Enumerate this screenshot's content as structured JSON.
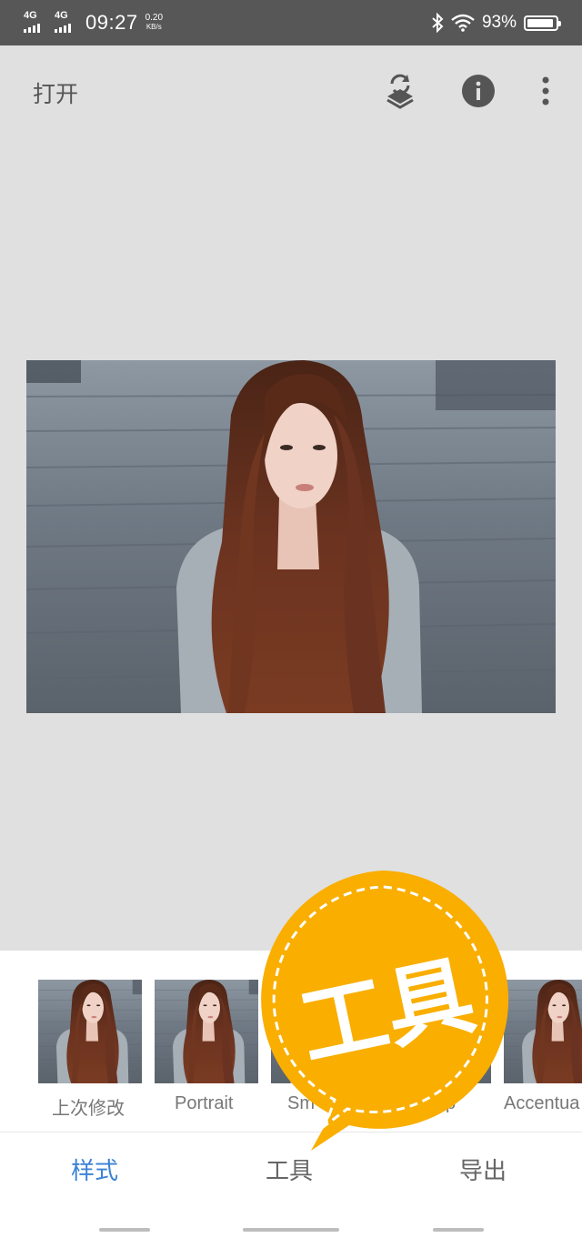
{
  "status_bar": {
    "network_1": "4G",
    "network_2": "4G",
    "time": "09:27",
    "speed_value": "0.20",
    "speed_unit": "KB/s",
    "battery_percent": "93%",
    "battery_level": 0.93
  },
  "app_bar": {
    "open_label": "打开",
    "icons": [
      "layers-undo-icon",
      "info-icon",
      "more-vert-icon"
    ]
  },
  "image": {
    "description_icon": "portrait-photo"
  },
  "styles": {
    "thumbnails": [
      {
        "label": "上次修改"
      },
      {
        "label": "Portrait"
      },
      {
        "label": "Sm"
      },
      {
        "label": "p"
      },
      {
        "label": "Accentua"
      }
    ]
  },
  "badge": {
    "text": "工具"
  },
  "tabs": [
    {
      "label": "样式",
      "active": true
    },
    {
      "label": "工具",
      "active": false
    },
    {
      "label": "导出",
      "active": false
    }
  ],
  "colors": {
    "accent": "#3b82d6",
    "badge": "#f9ae00",
    "status_bar": "#575757",
    "canvas": "#e0e0e0"
  }
}
